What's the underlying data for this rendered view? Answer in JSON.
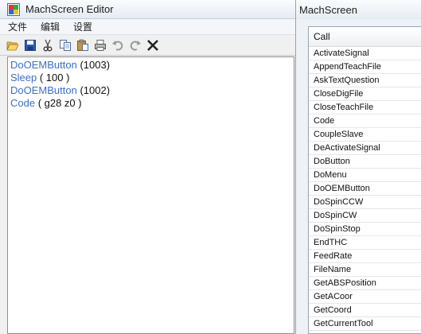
{
  "editor": {
    "title": "MachScreen Editor",
    "menu": [
      "文件",
      "编辑",
      "设置"
    ],
    "toolbar": [
      {
        "name": "open-icon"
      },
      {
        "name": "save-icon"
      },
      {
        "name": "cut-icon"
      },
      {
        "name": "copy-icon"
      },
      {
        "name": "paste-icon"
      },
      {
        "name": "print-icon"
      },
      {
        "name": "undo-icon"
      },
      {
        "name": "redo-icon"
      },
      {
        "name": "delete-icon"
      }
    ],
    "code_lines": [
      {
        "keyword": "DoOEMButton",
        "args": " (1003)"
      },
      {
        "keyword": "Sleep",
        "args": " ( 100 )"
      },
      {
        "keyword": "DoOEMButton",
        "args": " (1002)"
      },
      {
        "keyword": "Code",
        "args": " ( g28 z0 )"
      }
    ],
    "keyword_color": "#3c6fc2"
  },
  "panel": {
    "title": "MachScreen",
    "column_header": "Call",
    "items": [
      "ActivateSignal",
      "AppendTeachFile",
      "AskTextQuestion",
      "CloseDigFile",
      "CloseTeachFile",
      "Code",
      "CoupleSlave",
      "DeActivateSignal",
      "DoButton",
      "DoMenu",
      "DoOEMButton",
      "DoSpinCCW",
      "DoSpinCW",
      "DoSpinStop",
      "EndTHC",
      "FeedRate",
      "FileName",
      "GetABSPosition",
      "GetACoor",
      "GetCoord",
      "GetCurrentTool"
    ]
  }
}
